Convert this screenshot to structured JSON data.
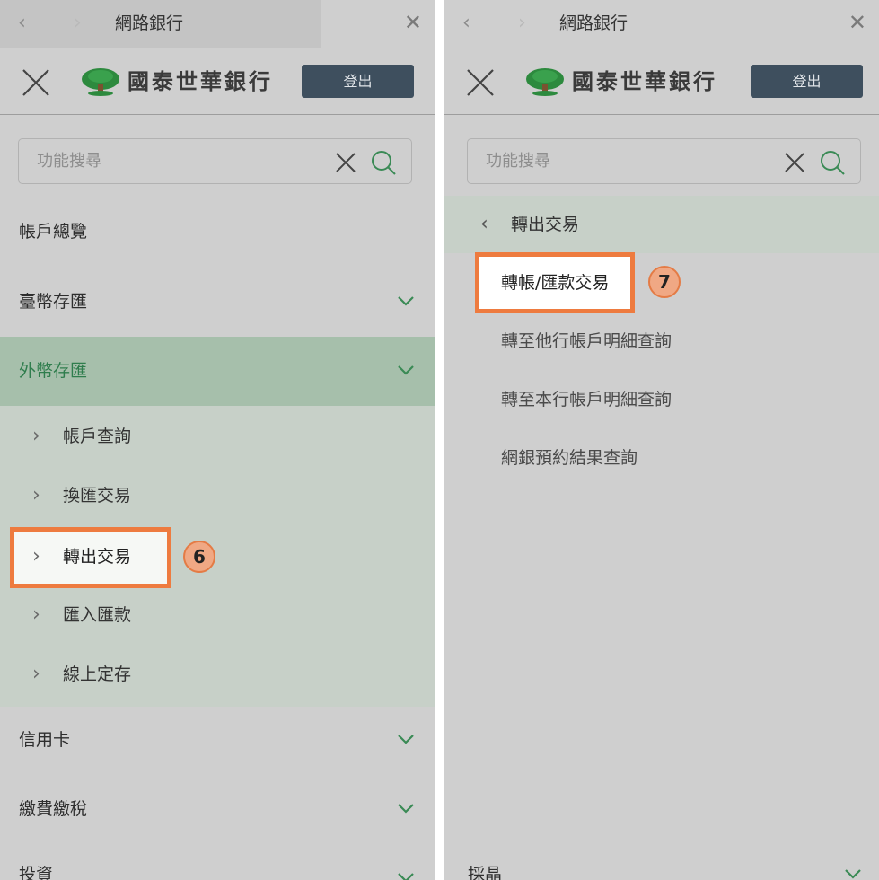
{
  "topbar": {
    "back_glyph": "‹",
    "forward_glyph": "›",
    "title": "網路銀行",
    "close_glyph": "✕"
  },
  "header": {
    "brand": "國泰世華銀行",
    "logout_label": "登出"
  },
  "search": {
    "placeholder": "功能搜尋"
  },
  "left_panel": {
    "menu": [
      {
        "label": "帳戶總覽"
      },
      {
        "label": "臺幣存匯"
      },
      {
        "label": "外幣存匯"
      },
      {
        "label": "信用卡"
      },
      {
        "label": "繳費繳稅"
      },
      {
        "label": "投資"
      }
    ],
    "submenu": [
      {
        "label": "帳戶查詢"
      },
      {
        "label": "換匯交易"
      },
      {
        "label": "轉出交易"
      },
      {
        "label": "匯入匯款"
      },
      {
        "label": "線上定存"
      }
    ],
    "step_badge": "6"
  },
  "right_panel": {
    "back_label": "轉出交易",
    "items": [
      {
        "label": "轉帳/匯款交易"
      },
      {
        "label": "轉至他行帳戶明細查詢"
      },
      {
        "label": "轉至本行帳戶明細查詢"
      },
      {
        "label": "網銀預約結果查詢"
      }
    ],
    "step_badge": "7",
    "bottom_cut_label": "採晶"
  },
  "colors": {
    "highlight": "#ee7b3f",
    "active_green": "#2f7d4d",
    "logout_bg": "#3e4f5e",
    "logo_green": "#2d8a3e"
  },
  "icons": {
    "back": "chevron-left-icon",
    "close": "close-icon",
    "search": "search-icon",
    "expand": "chevron-down-icon",
    "submenu_arrow": "chevron-right-icon",
    "logo": "tree-logo-icon"
  }
}
